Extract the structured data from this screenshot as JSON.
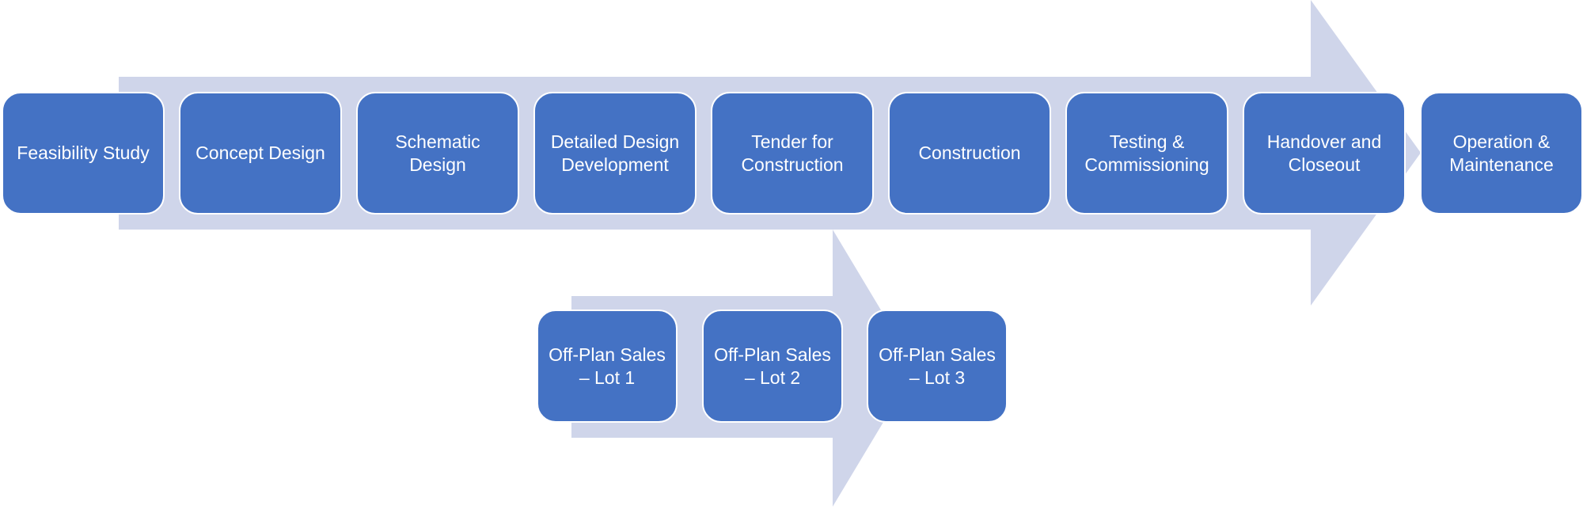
{
  "colors": {
    "box_fill": "#4472c4",
    "box_border": "#ffffff",
    "arrow_fill": "#cfd5ea",
    "text": "#ffffff"
  },
  "main_flow": {
    "steps": [
      {
        "label": "Feasibility Study"
      },
      {
        "label": "Concept Design"
      },
      {
        "label": "Schematic\nDesign"
      },
      {
        "label": "Detailed Design\nDevelopment"
      },
      {
        "label": "Tender for\nConstruction"
      },
      {
        "label": "Construction"
      },
      {
        "label": "Testing &\nCommissioning"
      },
      {
        "label": "Handover and\nCloseout"
      },
      {
        "label": "Operation &\nMaintenance"
      }
    ]
  },
  "sub_flow": {
    "steps": [
      {
        "label": "Off-Plan Sales\n– Lot 1"
      },
      {
        "label": "Off-Plan Sales\n– Lot 2"
      },
      {
        "label": "Off-Plan Sales\n– Lot 3"
      }
    ]
  }
}
